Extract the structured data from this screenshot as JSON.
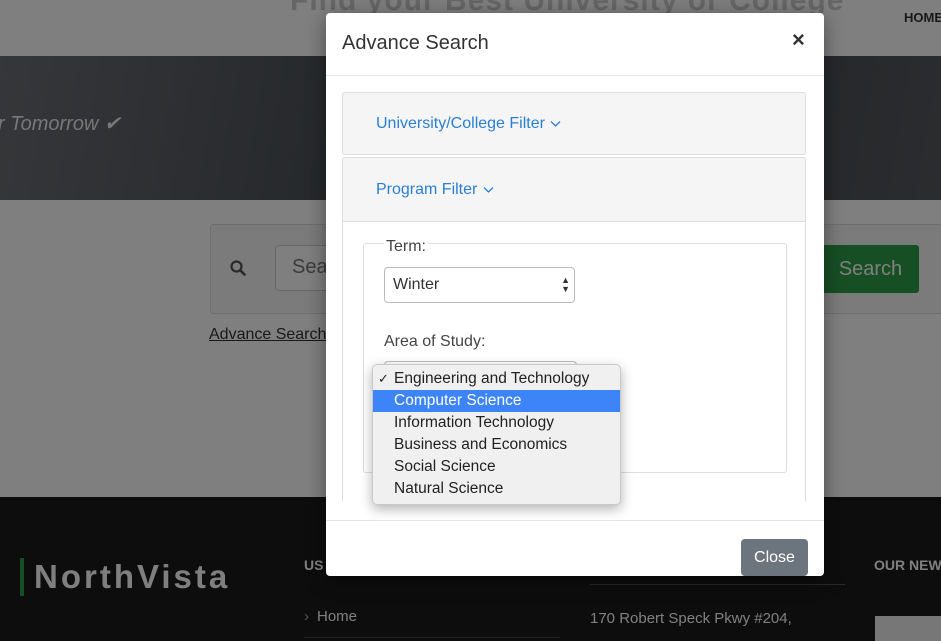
{
  "background": {
    "hero_title": "Find your Best University or College",
    "nav_home": "HOME",
    "hero_tagline": "r Tomorrow ✔",
    "search_placeholder": "Sea",
    "search_button": "Search",
    "advance_search_link": "Advance Search",
    "footer": {
      "brand": "NorthVista",
      "col1_heading": "US",
      "col1_link_home": "Home",
      "address": "170 Robert Speck Pkwy #204,",
      "col3_heading": "OUR NEW"
    }
  },
  "modal": {
    "title": "Advance Search",
    "close_symbol": "×",
    "panels": [
      {
        "title": "University/College Filter",
        "chevron": "﹀"
      },
      {
        "title": "Program Filter",
        "chevron": "﹀"
      }
    ],
    "term_label": "Term:",
    "term_value": "Winter",
    "area_label": "Area of Study:",
    "area_options": [
      {
        "label": "Engineering and Technology",
        "checked": true,
        "highlighted": false
      },
      {
        "label": "Computer Science",
        "checked": false,
        "highlighted": true
      },
      {
        "label": "Information Technology",
        "checked": false,
        "highlighted": false
      },
      {
        "label": "Business and Economics",
        "checked": false,
        "highlighted": false
      },
      {
        "label": "Social Science",
        "checked": false,
        "highlighted": false
      },
      {
        "label": "Natural Science",
        "checked": false,
        "highlighted": false
      }
    ],
    "close_button": "Close"
  },
  "colors": {
    "accent_green": "#2e9e48",
    "link_blue": "#2a7fd4",
    "highlight_blue": "#3c84f7",
    "close_button_gray": "#6c757d"
  }
}
